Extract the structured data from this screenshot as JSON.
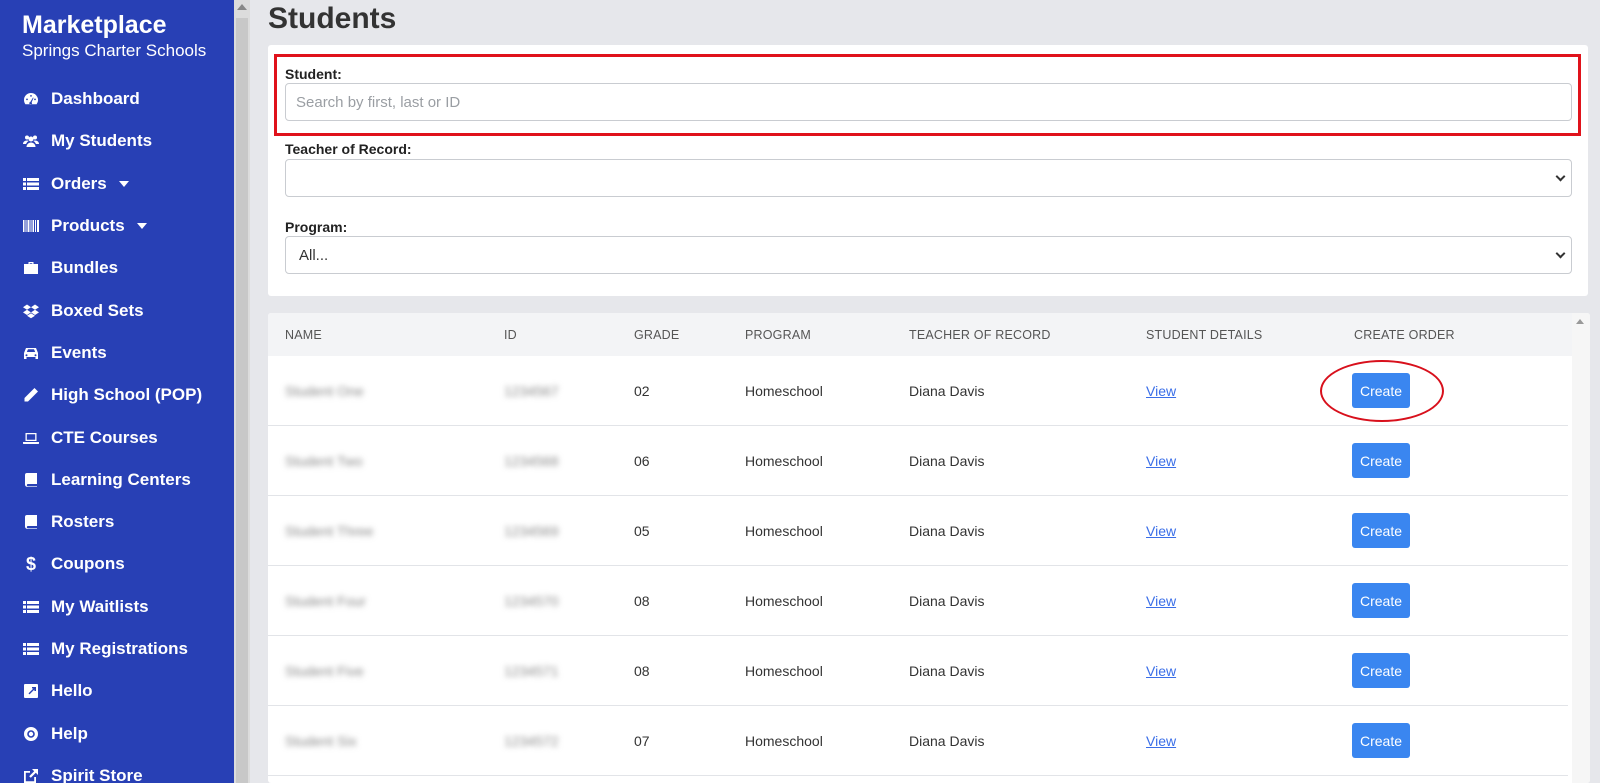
{
  "sidebar": {
    "title": "Marketplace",
    "subtitle": "Springs Charter Schools",
    "items": [
      {
        "label": "Dashboard",
        "icon": "dashboard-icon"
      },
      {
        "label": "My Students",
        "icon": "users-icon"
      },
      {
        "label": "Orders",
        "icon": "list-icon",
        "dropdown": true
      },
      {
        "label": "Products",
        "icon": "barcode-icon",
        "dropdown": true
      },
      {
        "label": "Bundles",
        "icon": "briefcase-icon"
      },
      {
        "label": "Boxed Sets",
        "icon": "dropbox-icon"
      },
      {
        "label": "Events",
        "icon": "car-icon"
      },
      {
        "label": "High School (POP)",
        "icon": "pencil-icon"
      },
      {
        "label": "CTE Courses",
        "icon": "laptop-icon"
      },
      {
        "label": "Learning Centers",
        "icon": "book-icon"
      },
      {
        "label": "Rosters",
        "icon": "book-icon"
      },
      {
        "label": "Coupons",
        "icon": "dollar-icon"
      },
      {
        "label": "My Waitlists",
        "icon": "list-icon"
      },
      {
        "label": "My Registrations",
        "icon": "list-icon"
      },
      {
        "label": "Hello",
        "icon": "external-square-icon"
      },
      {
        "label": "Help",
        "icon": "lifebuoy-icon"
      },
      {
        "label": "Spirit Store",
        "icon": "external-link-icon"
      }
    ]
  },
  "page": {
    "title": "Students"
  },
  "filters": {
    "student_label": "Student:",
    "student_placeholder": "Search by first, last or ID",
    "student_value": "",
    "teacher_label": "Teacher of Record:",
    "teacher_value": "",
    "program_label": "Program:",
    "program_value": "All..."
  },
  "table": {
    "headers": [
      "NAME",
      "ID",
      "GRADE",
      "PROGRAM",
      "TEACHER OF RECORD",
      "STUDENT DETAILS",
      "CREATE ORDER"
    ],
    "rows": [
      {
        "name": "Student One",
        "id": "1234567",
        "grade": "02",
        "program": "Homeschool",
        "teacher": "Diana Davis",
        "details": "View",
        "action": "Create"
      },
      {
        "name": "Student Two",
        "id": "1234568",
        "grade": "06",
        "program": "Homeschool",
        "teacher": "Diana Davis",
        "details": "View",
        "action": "Create"
      },
      {
        "name": "Student Three",
        "id": "1234569",
        "grade": "05",
        "program": "Homeschool",
        "teacher": "Diana Davis",
        "details": "View",
        "action": "Create"
      },
      {
        "name": "Student Four",
        "id": "1234570",
        "grade": "08",
        "program": "Homeschool",
        "teacher": "Diana Davis",
        "details": "View",
        "action": "Create"
      },
      {
        "name": "Student Five",
        "id": "1234571",
        "grade": "08",
        "program": "Homeschool",
        "teacher": "Diana Davis",
        "details": "View",
        "action": "Create"
      },
      {
        "name": "Student Six",
        "id": "1234572",
        "grade": "07",
        "program": "Homeschool",
        "teacher": "Diana Davis",
        "details": "View",
        "action": "Create"
      }
    ]
  },
  "colors": {
    "sidebar": "#2840b5",
    "accent": "#3a86f0",
    "annotation": "#e0121b"
  }
}
